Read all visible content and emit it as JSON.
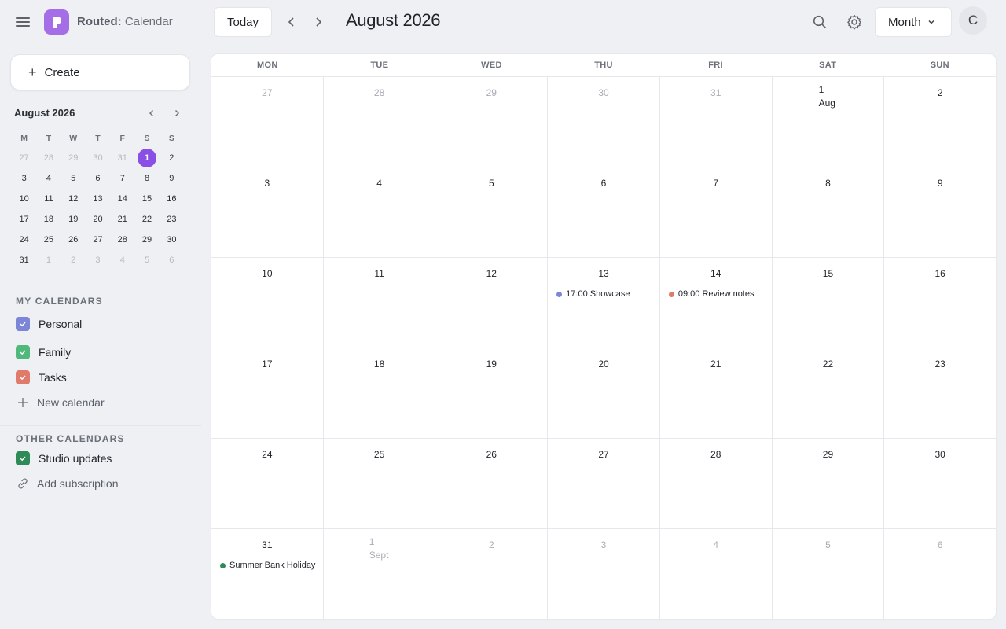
{
  "app": {
    "brand": "Routed:",
    "name": "Calendar"
  },
  "toolbar": {
    "today_label": "Today",
    "month_title": "August 2026",
    "view_label": "Month",
    "avatar_initial": "C"
  },
  "sidebar": {
    "create_label": "Create",
    "mini_title": "August 2026",
    "mini_weekdays": [
      "M",
      "T",
      "W",
      "T",
      "F",
      "S",
      "S"
    ],
    "mini_weeks": [
      [
        "27",
        "28",
        "29",
        "30",
        "31",
        "1",
        "2"
      ],
      [
        "3",
        "4",
        "5",
        "6",
        "7",
        "8",
        "9"
      ],
      [
        "10",
        "11",
        "12",
        "13",
        "14",
        "15",
        "16"
      ],
      [
        "17",
        "18",
        "19",
        "20",
        "21",
        "22",
        "23"
      ],
      [
        "24",
        "25",
        "26",
        "27",
        "28",
        "29",
        "30"
      ],
      [
        "31",
        "1",
        "2",
        "3",
        "4",
        "5",
        "6"
      ]
    ],
    "my_calendars_heading": "MY CALENDARS",
    "my_calendars": [
      {
        "label": "Personal",
        "color": "#7b86d6"
      },
      {
        "label": "Family",
        "color": "#4fb87a"
      },
      {
        "label": "Tasks",
        "color": "#e07a6a"
      }
    ],
    "new_calendar_label": "New calendar",
    "other_calendars_heading": "OTHER CALENDARS",
    "other_calendars": [
      {
        "label": "Studio updates",
        "color": "#2e8b57"
      }
    ],
    "add_subscription_label": "Add subscription"
  },
  "calendar": {
    "weekdays": [
      "MON",
      "TUE",
      "WED",
      "THU",
      "FRI",
      "SAT",
      "SUN"
    ],
    "weeks": [
      [
        {
          "d": "27"
        },
        {
          "d": "28"
        },
        {
          "d": "29"
        },
        {
          "d": "30"
        },
        {
          "d": "31"
        },
        {
          "d": "1",
          "m": "Aug"
        },
        {
          "d": "2"
        }
      ],
      [
        {
          "d": "3"
        },
        {
          "d": "4"
        },
        {
          "d": "5"
        },
        {
          "d": "6"
        },
        {
          "d": "7"
        },
        {
          "d": "8"
        },
        {
          "d": "9"
        }
      ],
      [
        {
          "d": "10"
        },
        {
          "d": "11"
        },
        {
          "d": "12"
        },
        {
          "d": "13",
          "event": "17:00 Showcase",
          "color": "#7b86d6"
        },
        {
          "d": "14",
          "event": "09:00 Review notes",
          "color": "#e07a6a"
        },
        {
          "d": "15"
        },
        {
          "d": "16"
        }
      ],
      [
        {
          "d": "17"
        },
        {
          "d": "18"
        },
        {
          "d": "19"
        },
        {
          "d": "20"
        },
        {
          "d": "21"
        },
        {
          "d": "22"
        },
        {
          "d": "23"
        }
      ],
      [
        {
          "d": "24"
        },
        {
          "d": "25"
        },
        {
          "d": "26"
        },
        {
          "d": "27"
        },
        {
          "d": "28"
        },
        {
          "d": "29"
        },
        {
          "d": "30"
        }
      ],
      [
        {
          "d": "31",
          "event": "Summer Bank Holiday",
          "color": "#2e8b57"
        },
        {
          "d": "1",
          "m": "Sept"
        },
        {
          "d": "2"
        },
        {
          "d": "3"
        },
        {
          "d": "4"
        },
        {
          "d": "5"
        },
        {
          "d": "6"
        }
      ]
    ]
  }
}
